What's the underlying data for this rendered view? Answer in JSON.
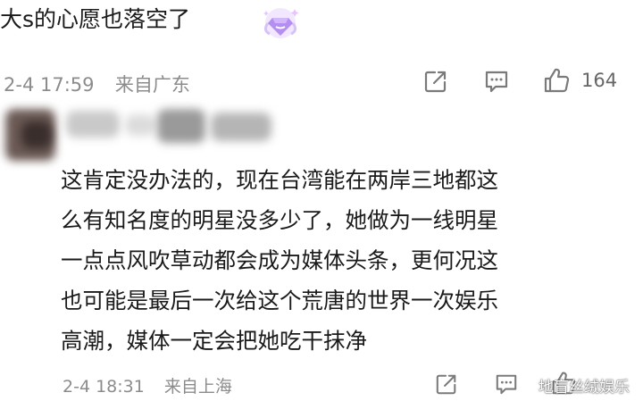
{
  "comment1": {
    "text": "大s的心愿也落空了",
    "badge_icon": "gem-badge-icon",
    "date": "2-4 17:59",
    "location": "来自广东",
    "like_count": "164"
  },
  "comment2": {
    "lines": [
      "这肯定没办法的，现在台湾能在两岸三地都这",
      "么有知名度的明星没多少了，她做为一线明星",
      "一点点风吹草动都会成为媒体头条，更何况这",
      "也可能是最后一次给这个荒唐的世界一次娱乐",
      "高潮，媒体一定会把她吃干抹净"
    ],
    "date": "2-4 18:31",
    "location": "来自上海"
  },
  "watermark": "地盲丝绒娱乐",
  "colors": {
    "meta": "#8c8c8c",
    "icon": "#7a7a7a",
    "badge": "#b48ef0"
  }
}
